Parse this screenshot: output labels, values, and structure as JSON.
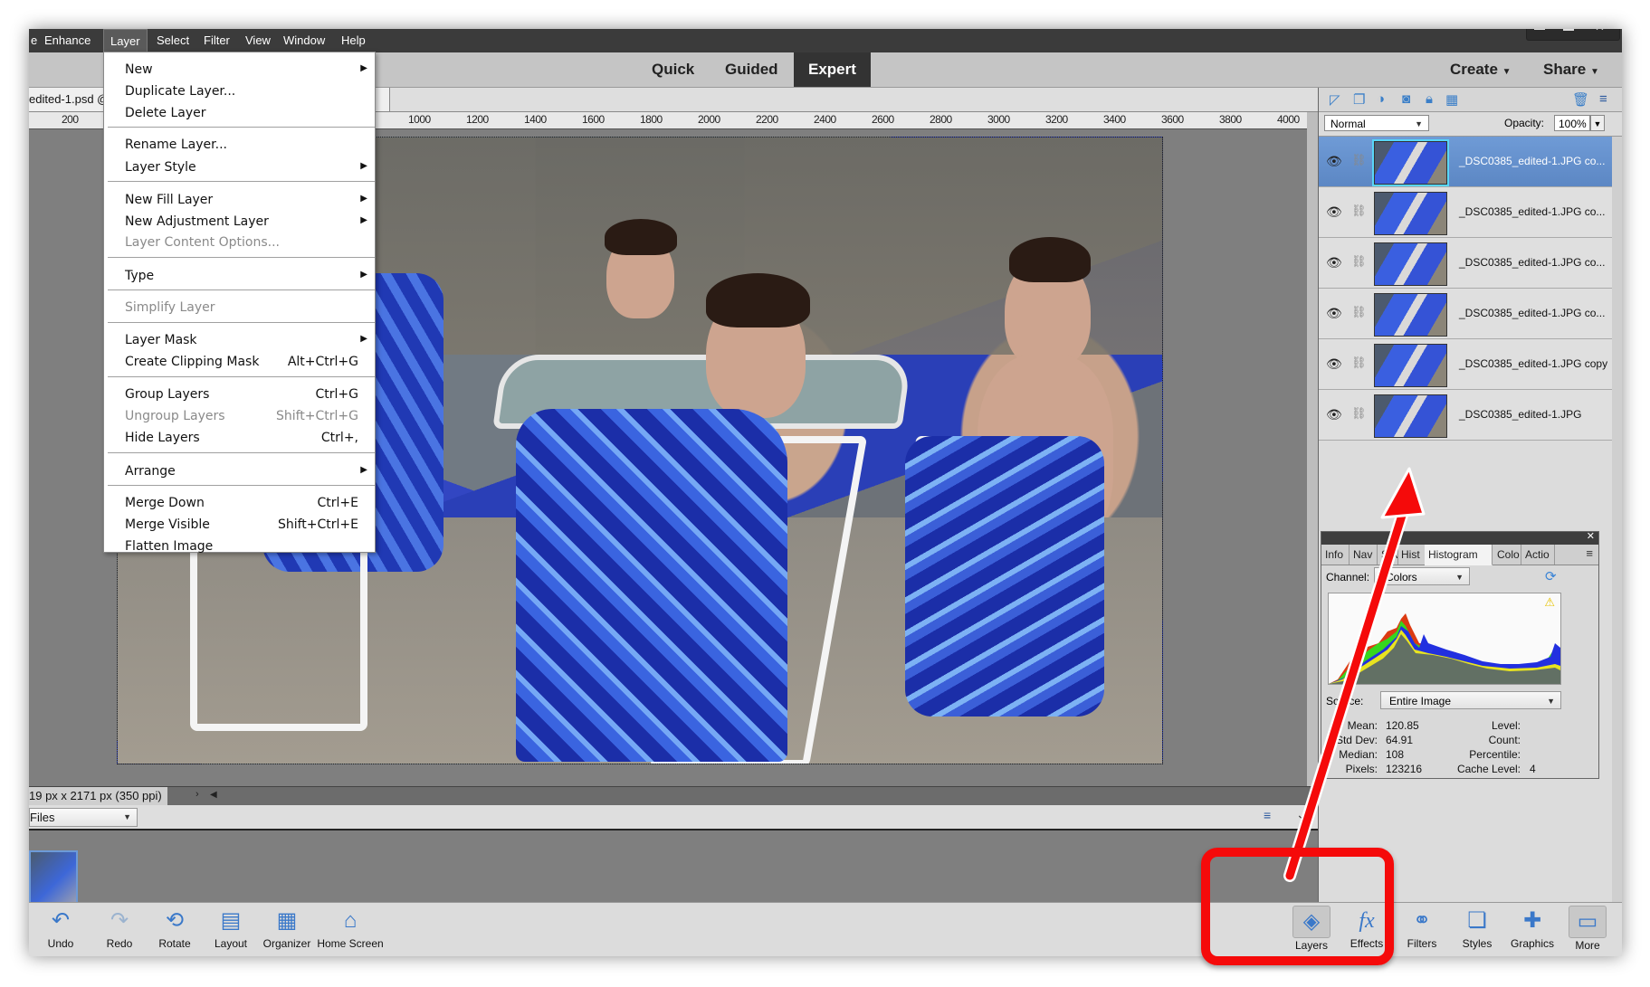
{
  "menubar": {
    "items": [
      "e",
      "Enhance",
      "Layer",
      "Select",
      "Filter",
      "View",
      "Window",
      "Help"
    ],
    "active": "Layer"
  },
  "modes": {
    "quick": "Quick",
    "guided": "Guided",
    "expert": "Expert",
    "active": "Expert"
  },
  "top_actions": {
    "create": "Create",
    "share": "Share"
  },
  "document": {
    "tab_title": "edited-1.psd @",
    "dimensions": "19 px x 2171 px (350 ppi)"
  },
  "ruler": {
    "ticks": [
      "200",
      "1000",
      "1200",
      "1400",
      "1600",
      "1800",
      "2000",
      "2200",
      "2400",
      "2600",
      "2800",
      "3000",
      "3200",
      "3400",
      "3600",
      "3800",
      "4000"
    ]
  },
  "layer_menu": {
    "items": [
      {
        "label": "New",
        "submenu": true,
        "disabled": false,
        "shortcut": ""
      },
      {
        "label": "Duplicate Layer...",
        "submenu": false,
        "disabled": false,
        "shortcut": ""
      },
      {
        "label": "Delete Layer",
        "submenu": false,
        "disabled": false,
        "shortcut": ""
      },
      {
        "label": "Rename Layer...",
        "submenu": false,
        "disabled": false,
        "shortcut": ""
      },
      {
        "label": "Layer Style",
        "submenu": true,
        "disabled": false,
        "shortcut": ""
      },
      {
        "label": "New Fill Layer",
        "submenu": true,
        "disabled": false,
        "shortcut": ""
      },
      {
        "label": "New Adjustment Layer",
        "submenu": true,
        "disabled": false,
        "shortcut": ""
      },
      {
        "label": "Layer Content Options...",
        "submenu": false,
        "disabled": true,
        "shortcut": ""
      },
      {
        "label": "Type",
        "submenu": true,
        "disabled": false,
        "shortcut": ""
      },
      {
        "label": "Simplify Layer",
        "submenu": false,
        "disabled": true,
        "shortcut": ""
      },
      {
        "label": "Layer Mask",
        "submenu": true,
        "disabled": false,
        "shortcut": ""
      },
      {
        "label": "Create Clipping Mask",
        "submenu": false,
        "disabled": false,
        "shortcut": "Alt+Ctrl+G"
      },
      {
        "label": "Group Layers",
        "submenu": false,
        "disabled": false,
        "shortcut": "Ctrl+G"
      },
      {
        "label": "Ungroup Layers",
        "submenu": false,
        "disabled": true,
        "shortcut": "Shift+Ctrl+G"
      },
      {
        "label": "Hide Layers",
        "submenu": false,
        "disabled": false,
        "shortcut": "Ctrl+,"
      },
      {
        "label": "Arrange",
        "submenu": true,
        "disabled": false,
        "shortcut": ""
      },
      {
        "label": "Merge Down",
        "submenu": false,
        "disabled": false,
        "shortcut": "Ctrl+E"
      },
      {
        "label": "Merge Visible",
        "submenu": false,
        "disabled": false,
        "shortcut": "Shift+Ctrl+E"
      },
      {
        "label": "Flatten Image",
        "submenu": false,
        "disabled": false,
        "shortcut": ""
      }
    ]
  },
  "layers_panel": {
    "blend_mode": "Normal",
    "opacity_label": "Opacity:",
    "opacity": "100%",
    "layers": [
      {
        "name": "_DSC0385_edited-1.JPG co...",
        "selected": true
      },
      {
        "name": "_DSC0385_edited-1.JPG co...",
        "selected": false
      },
      {
        "name": "_DSC0385_edited-1.JPG co...",
        "selected": false
      },
      {
        "name": "_DSC0385_edited-1.JPG co...",
        "selected": false
      },
      {
        "name": "_DSC0385_edited-1.JPG copy",
        "selected": false
      },
      {
        "name": "_DSC0385_edited-1.JPG",
        "selected": false
      }
    ]
  },
  "histogram_panel": {
    "tabs": [
      "Info",
      "Nav",
      "Save",
      "Hist",
      "Histogram",
      "Colo",
      "Actio"
    ],
    "active_tab": "Histogram",
    "channel_label": "Channel:",
    "channel": "Colors",
    "source_label": "Source:",
    "source": "Entire Image",
    "stats": {
      "mean_label": "Mean:",
      "mean": "120.85",
      "stddev_label": "Std Dev:",
      "stddev": "64.91",
      "median_label": "Median:",
      "median": "108",
      "pixels_label": "Pixels:",
      "pixels": "123216",
      "level_label": "Level:",
      "level": "",
      "count_label": "Count:",
      "count": "",
      "percentile_label": "Percentile:",
      "percentile": "",
      "cache_label": "Cache Level:",
      "cache": "4"
    }
  },
  "photo_bin": {
    "source": "Files"
  },
  "bottom_left_tools": [
    {
      "label": "Undo",
      "icon": "undo-icon"
    },
    {
      "label": "Redo",
      "icon": "redo-icon"
    },
    {
      "label": "Rotate",
      "icon": "rotate-icon"
    },
    {
      "label": "Layout",
      "icon": "layout-icon"
    },
    {
      "label": "Organizer",
      "icon": "organizer-icon"
    },
    {
      "label": "Home Screen",
      "icon": "home-icon"
    }
  ],
  "bottom_right_tools": [
    {
      "label": "Layers",
      "icon": "layers-icon"
    },
    {
      "label": "Effects",
      "icon": "fx-icon"
    },
    {
      "label": "Filters",
      "icon": "filters-icon"
    },
    {
      "label": "Styles",
      "icon": "styles-icon"
    },
    {
      "label": "Graphics",
      "icon": "graphics-icon"
    },
    {
      "label": "More",
      "icon": "more-icon"
    }
  ],
  "annotation": {
    "color": "#f50a0a"
  }
}
